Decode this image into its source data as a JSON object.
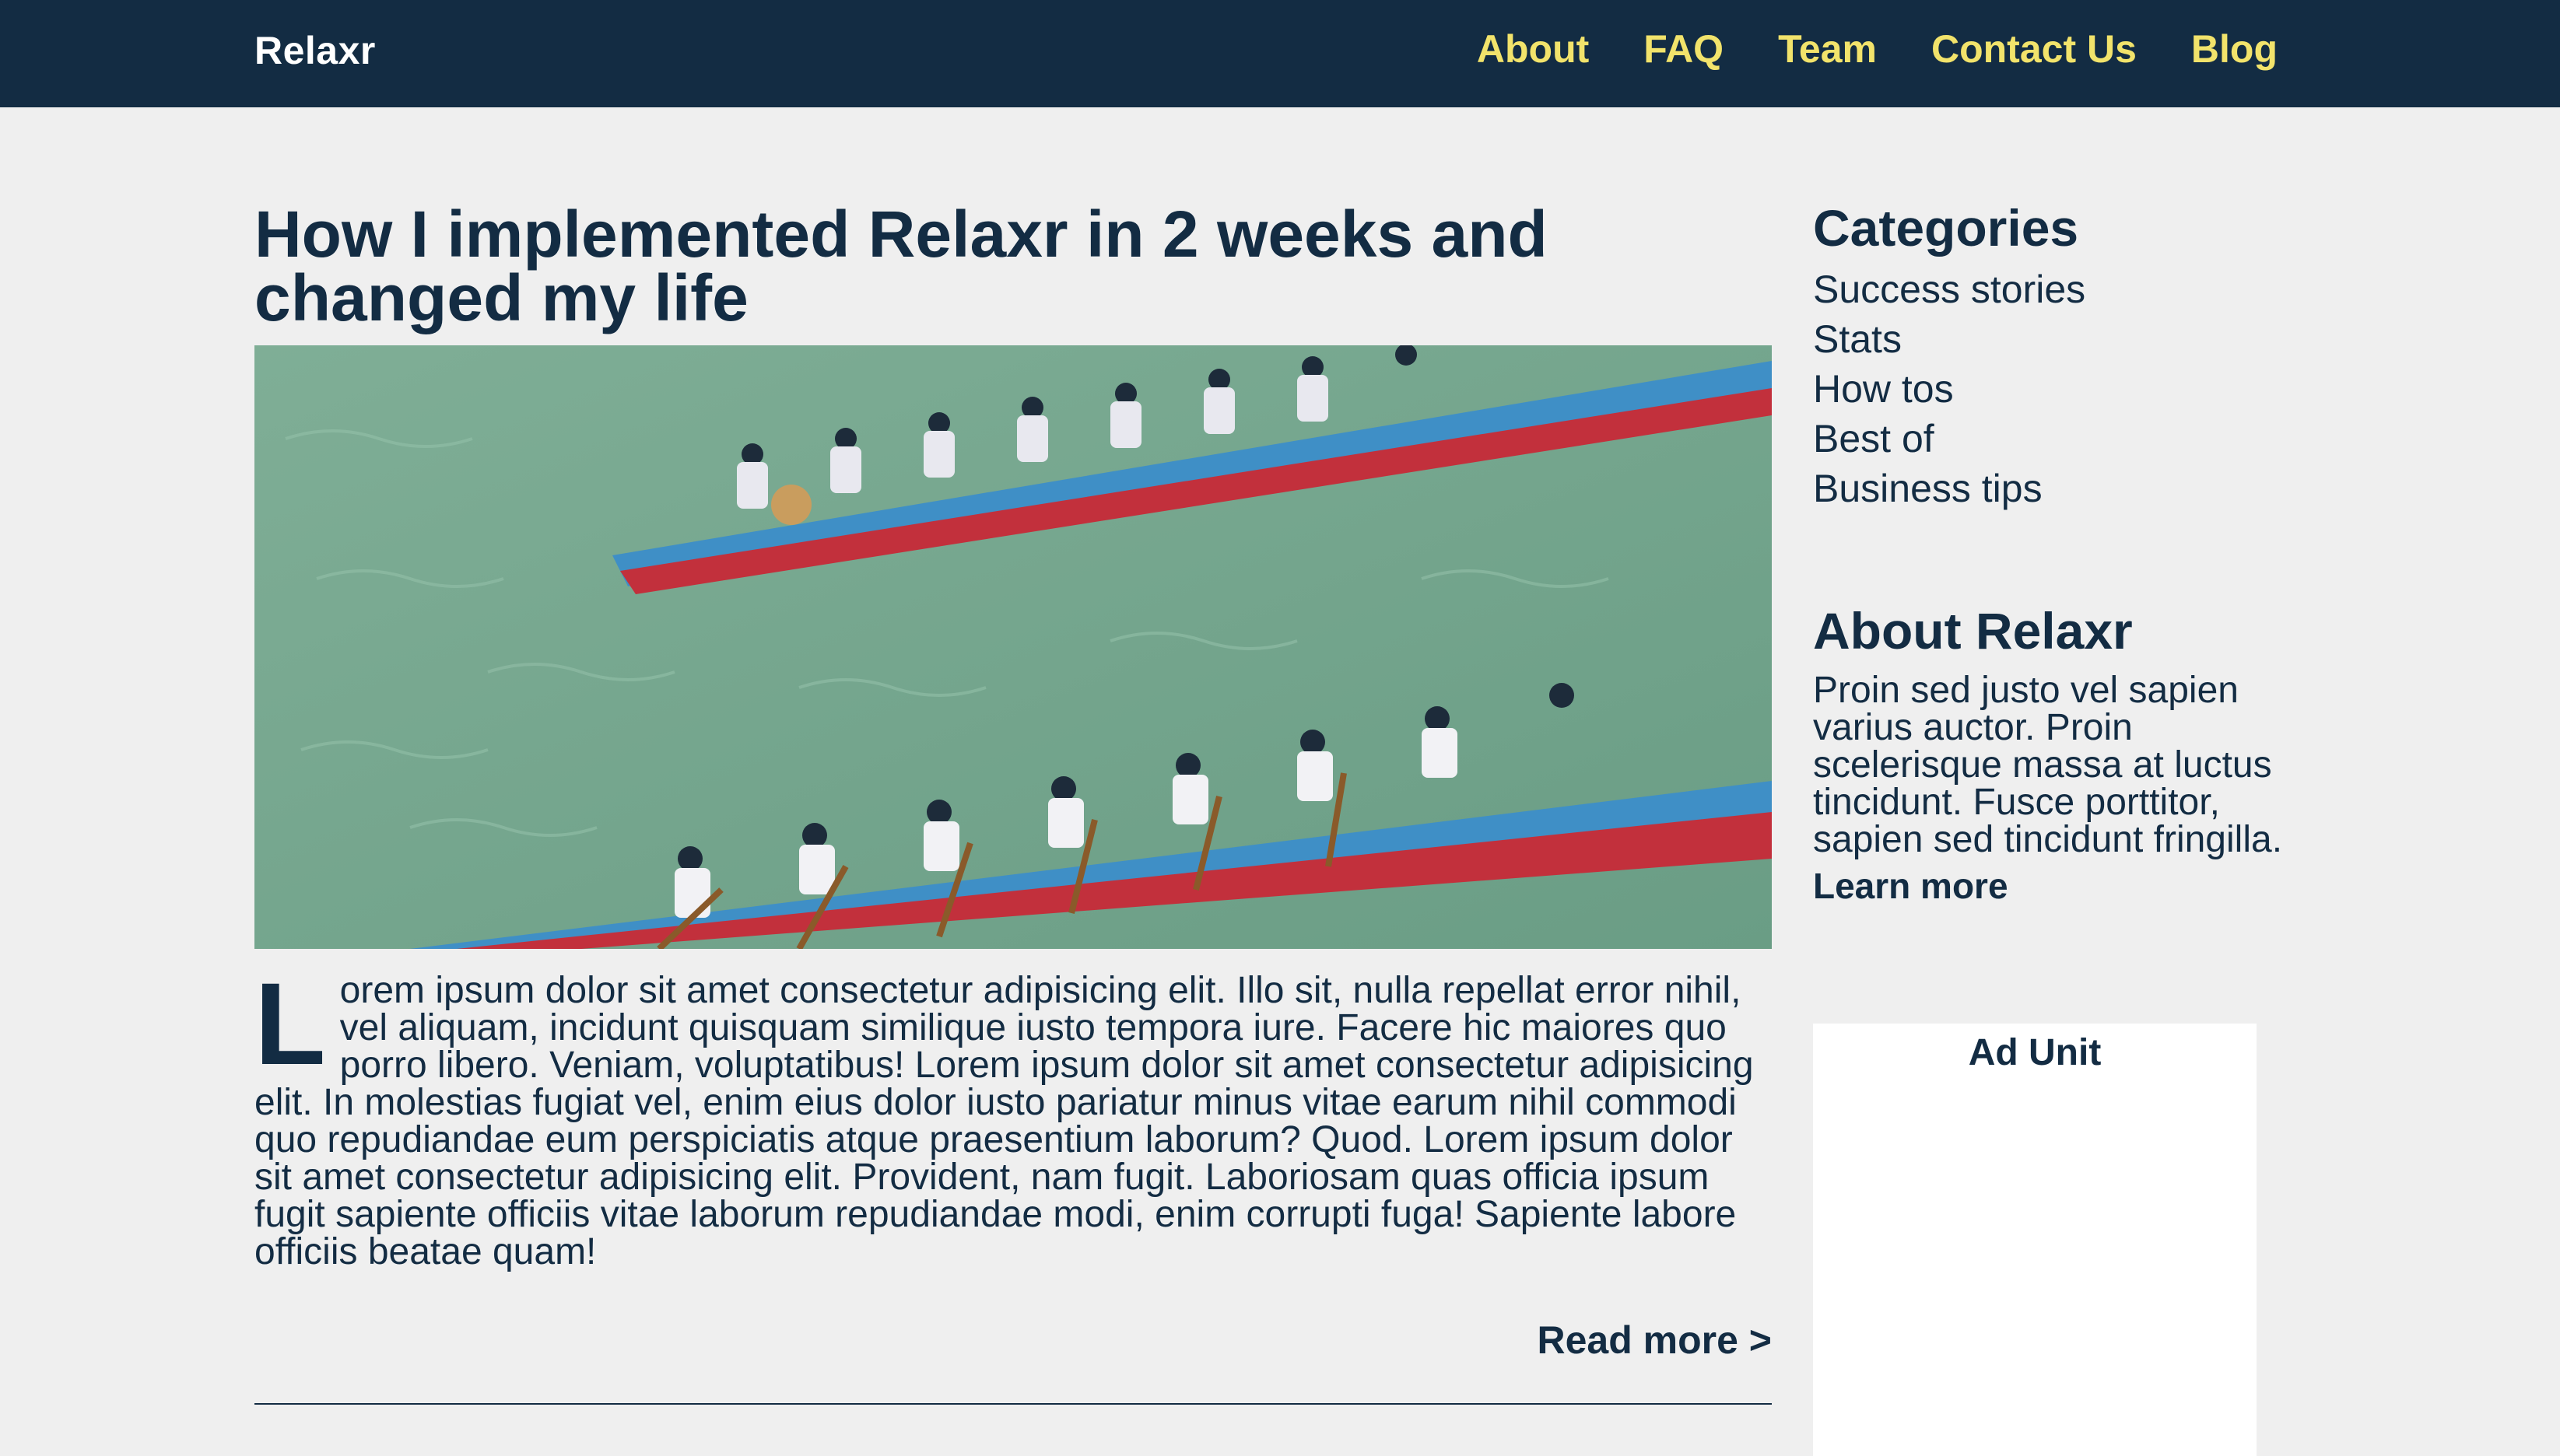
{
  "header": {
    "brand": "Relaxr",
    "nav": [
      "About",
      "FAQ",
      "Team",
      "Contact Us",
      "Blog"
    ]
  },
  "post": {
    "title": "How I implemented Relaxr in 2 weeks and changed my life",
    "image_alt": "dragon-boat-race-photo",
    "dropcap": "L",
    "body": "orem ipsum dolor sit amet consectetur adipisicing elit. Illo sit, nulla repellat error nihil, vel aliquam, incidunt quisquam similique iusto tempora iure. Facere hic maiores quo porro libero. Veniam, voluptatibus! Lorem ipsum dolor sit amet consectetur adipisicing elit. In molestias fugiat vel, enim eius dolor iusto pariatur minus vitae earum nihil commodi quo repudiandae eum perspiciatis atque praesentium laborum? Quod. Lorem ipsum dolor sit amet consectetur adipisicing elit. Provident, nam fugit. Laboriosam quas officia ipsum fugit sapiente officiis vitae laborum repudiandae modi, enim corrupti fuga! Sapiente labore officiis beatae quam!",
    "read_more": "Read more >"
  },
  "sidebar": {
    "categories_heading": "Categories",
    "categories": [
      "Success stories",
      "Stats",
      "How tos",
      "Best of",
      "Business tips"
    ],
    "about_heading": "About Relaxr",
    "about_text": "Proin sed justo vel sapien varius auctor. Proin scelerisque massa at luctus tincidunt. Fusce porttitor, sapien sed tincidunt fringilla.",
    "learn_more": "Learn more",
    "ad_label": "Ad Unit"
  },
  "colors": {
    "navy": "#132c43",
    "nav_link": "#f2e36b",
    "page_bg": "#efefef"
  }
}
